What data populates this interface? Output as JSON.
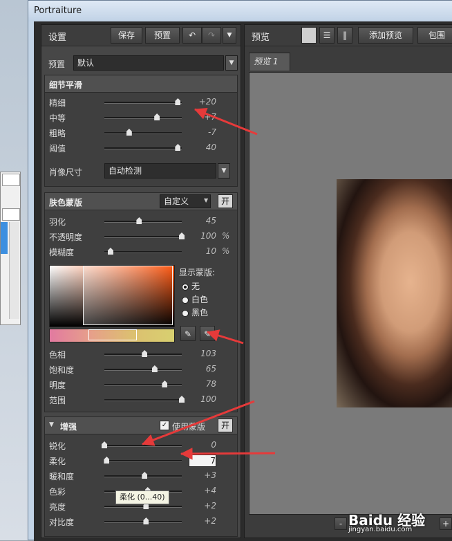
{
  "window": {
    "title": "Portraiture"
  },
  "toolbar": {
    "settings_label": "设置",
    "save_label": "保存",
    "preset_label": "预置",
    "undo_icon": "undo-icon",
    "redo_icon": "redo-icon",
    "menu_icon": "chevron-down-icon"
  },
  "preset": {
    "label": "预置",
    "value": "默认"
  },
  "detail": {
    "title": "细节平滑",
    "sliders": [
      {
        "label": "精细",
        "value": "+20",
        "fraction": 0.95
      },
      {
        "label": "中等",
        "value": "+7",
        "fraction": 0.68
      },
      {
        "label": "粗略",
        "value": "-7",
        "fraction": 0.32
      },
      {
        "label": "阈值",
        "value": "40",
        "fraction": 0.95
      }
    ],
    "size_label": "肖像尺寸",
    "size_value": "自动检测"
  },
  "skin": {
    "title": "肤色蒙版",
    "mode_value": "自定义",
    "toggle_label": "开",
    "sliders": [
      {
        "label": "羽化",
        "value": "45",
        "unit": "",
        "fraction": 0.45
      },
      {
        "label": "不透明度",
        "value": "100",
        "unit": "%",
        "fraction": 1.0
      },
      {
        "label": "模糊度",
        "value": "10",
        "unit": "%",
        "fraction": 0.08
      }
    ],
    "show_mask_label": "显示蒙版:",
    "radio": [
      "无",
      "白色",
      "黑色"
    ],
    "radio_selected": 0,
    "color_sliders": [
      {
        "label": "色相",
        "value": "103",
        "fraction": 0.52
      },
      {
        "label": "饱和度",
        "value": "65",
        "fraction": 0.65
      },
      {
        "label": "明度",
        "value": "78",
        "fraction": 0.78
      },
      {
        "label": "范围",
        "value": "100",
        "fraction": 1.0
      }
    ]
  },
  "enhance": {
    "title": "增强",
    "use_mask_label": "使用蒙版",
    "use_mask_checked": true,
    "toggle_label": "开",
    "sliders": [
      {
        "label": "锐化",
        "value": "0",
        "fraction": 0.0
      },
      {
        "label": "柔化",
        "value": "7",
        "fraction": 0.03
      },
      {
        "label": "暖和度",
        "value": "+3",
        "fraction": 0.52
      },
      {
        "label": "色彩",
        "value": "+4",
        "fraction": 0.56
      },
      {
        "label": "亮度",
        "value": "+2",
        "fraction": 0.54
      },
      {
        "label": "对比度",
        "value": "+2",
        "fraction": 0.54
      }
    ],
    "tooltip": "柔化 (0...40)"
  },
  "preview": {
    "title": "预览",
    "add_label": "添加预览",
    "wrap_label": "包围",
    "tab_label": "预览 1",
    "zoom_minus": "-",
    "zoom_plus": "+"
  },
  "watermark": {
    "text": "Baidu 经验",
    "url": "jingyan.baidu.com"
  },
  "colors": {
    "accent_arrow": "#e63a3a",
    "panel": "#474747"
  }
}
